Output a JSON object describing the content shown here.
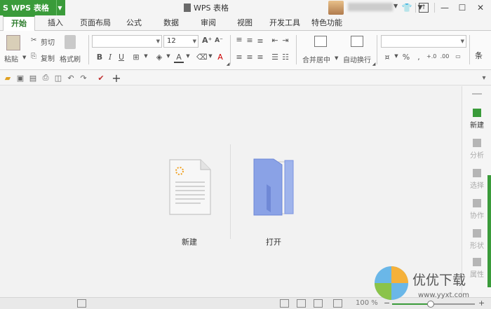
{
  "app": {
    "name": "WPS 表格",
    "logo": "S"
  },
  "window": {
    "title": "WPS 表格"
  },
  "tabs": [
    {
      "label": "开始",
      "active": true
    },
    {
      "label": "插入"
    },
    {
      "label": "页面布局"
    },
    {
      "label": "公式"
    },
    {
      "label": "数据"
    },
    {
      "label": "审阅"
    },
    {
      "label": "视图"
    },
    {
      "label": "开发工具"
    },
    {
      "label": "特色功能"
    }
  ],
  "ribbon": {
    "paste": "粘贴",
    "cut": "剪切",
    "copy": "复制",
    "format_painter": "格式刷",
    "font_size": "12",
    "merge_center": "合并居中",
    "wrap_text": "自动换行",
    "overflow_char": "条"
  },
  "main": {
    "new_label": "新建",
    "open_label": "打开"
  },
  "sidebar": [
    {
      "label": "新建",
      "active": true
    },
    {
      "label": "分析"
    },
    {
      "label": "选择"
    },
    {
      "label": "协作"
    },
    {
      "label": "形状"
    },
    {
      "label": "属性"
    }
  ],
  "status": {
    "zoom": "100 %",
    "zoom_fraction": 0.47
  },
  "watermark": {
    "text": "优优下载",
    "url": "www.yyxt.com"
  },
  "colors": {
    "accent": "#3a9b3a",
    "folder": "#7b93e0",
    "doc": "#f7f7f7"
  }
}
